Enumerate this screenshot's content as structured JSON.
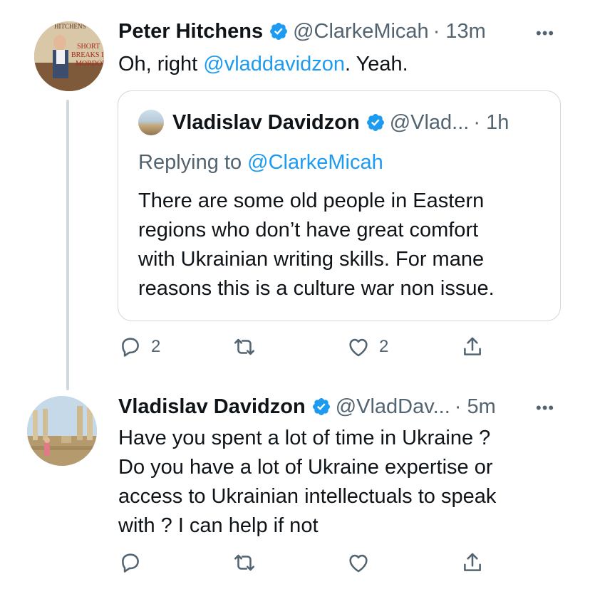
{
  "tweet1": {
    "author_name": "Peter Hitchens",
    "handle": "@ClarkeMicah",
    "time": "· 13m",
    "more": "•••",
    "text_prefix": "Oh, right ",
    "mention": "@vladdavidzon",
    "text_suffix": ". Yeah.",
    "avatar_caption": [
      "HITCHENS",
      "SHORT",
      "BREAKS IN",
      "MORDOR"
    ],
    "actions": {
      "replies": "2",
      "retweets": "",
      "likes": "2"
    }
  },
  "quoted": {
    "author_name": "Vladislav Davidzon",
    "handle": "@Vlad...",
    "time": "· 1h",
    "replying_prefix": "Replying to ",
    "replying_handle": "@ClarkeMicah",
    "lines": [
      "There are some old people in Eastern",
      "regions who don’t have great comfort",
      "with Ukrainian writing skills. For mane",
      "reasons this is a culture war non issue."
    ]
  },
  "tweet2": {
    "author_name": "Vladislav Davidzon",
    "handle": "@VladDav...",
    "time": "· 5m",
    "more": "•••",
    "lines": [
      "Have you spent a lot of time in Ukraine ?",
      "Do you have a lot of Ukraine expertise or",
      "access to Ukrainian intellectuals to speak",
      "with ? I can help if not"
    ]
  },
  "colors": {
    "accent": "#1d9bf0",
    "secondary_text": "#536471",
    "border": "#cfd9de"
  }
}
